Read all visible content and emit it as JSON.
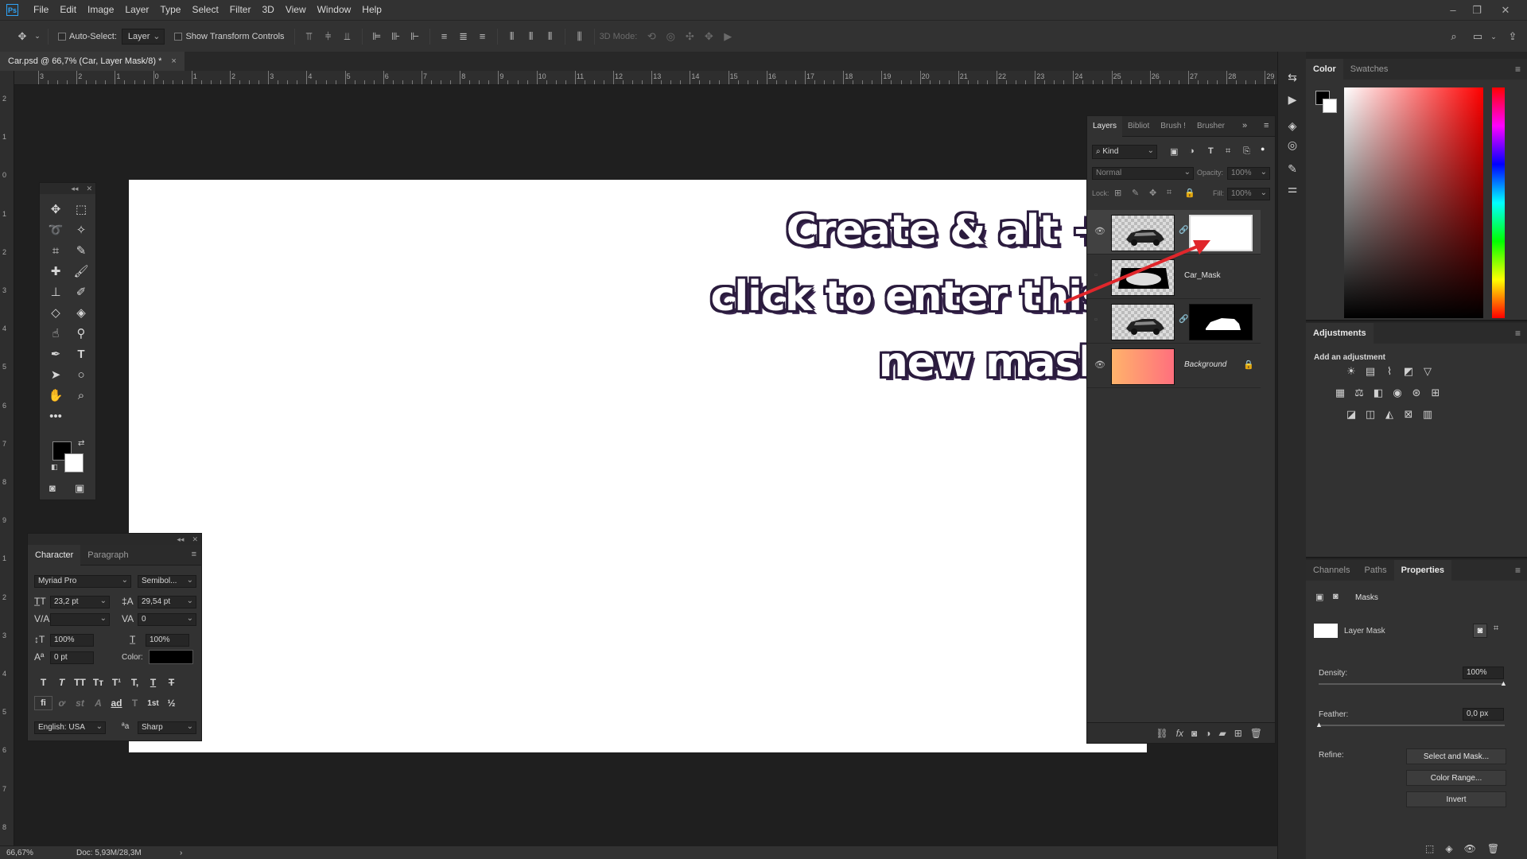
{
  "app": {
    "logo": "Ps"
  },
  "menubar": {
    "items": [
      "File",
      "Edit",
      "Image",
      "Layer",
      "Type",
      "Select",
      "Filter",
      "3D",
      "View",
      "Window",
      "Help"
    ]
  },
  "optionsbar": {
    "auto_select_label": "Auto-Select:",
    "auto_select_value": "Layer",
    "show_transform_label": "Show Transform Controls",
    "mode_3d_label": "3D Mode:"
  },
  "document": {
    "tab_title": "Car.psd @ 66,7% (Car, Layer Mask/8) *",
    "close": "×"
  },
  "rulers": {
    "h_labels": [
      "3",
      "2",
      "1",
      "0",
      "1",
      "2",
      "3",
      "4",
      "5",
      "6",
      "7",
      "8",
      "9",
      "10",
      "11",
      "12",
      "13",
      "14",
      "15",
      "16",
      "17",
      "18",
      "19",
      "20",
      "21",
      "22",
      "23",
      "24",
      "25",
      "26",
      "27",
      "28",
      "29"
    ],
    "v_labels": [
      "2",
      "1",
      "0",
      "1",
      "2",
      "3",
      "4",
      "5",
      "6",
      "7",
      "8",
      "9",
      "1",
      "2",
      "3",
      "4",
      "5",
      "6",
      "7",
      "8",
      "9"
    ]
  },
  "annotation": {
    "line1": "Create & alt +",
    "line2": "click to enter this",
    "line3": "new mask"
  },
  "status": {
    "zoom": "66,67%",
    "doc": "Doc: 5,93M/28,3M",
    "arrow": "›"
  },
  "character": {
    "tabs": [
      "Character",
      "Paragraph"
    ],
    "font_family": "Myriad Pro",
    "font_style": "Semibol...",
    "size": "23,2 pt",
    "leading": "29,54 pt",
    "kerning": "",
    "tracking": "0",
    "vscale": "100%",
    "hscale": "100%",
    "baseline": "0 pt",
    "color_label": "Color:",
    "type_buttons": [
      "T",
      "T",
      "TT",
      "Tт",
      "T¹",
      "T,",
      "T",
      "T"
    ],
    "ot_buttons": [
      "fi",
      "ơ",
      "st",
      "A",
      "ad",
      "T",
      "1st",
      "½"
    ],
    "language": "English: USA",
    "aa_label": "ªa",
    "antialias": "Sharp"
  },
  "layers": {
    "tabs": [
      "Layers",
      "Bibliot",
      "Brush !",
      "Brusher"
    ],
    "filter_kind": "Kind",
    "blend_mode": "Normal",
    "opacity_label": "Opacity:",
    "opacity": "100%",
    "lock_label": "Lock:",
    "fill_label": "Fill:",
    "fill": "100%",
    "items": [
      {
        "name": "",
        "visible": true
      },
      {
        "name": "Car_Mask",
        "visible": false
      },
      {
        "name": "",
        "visible": false
      },
      {
        "name": "Background",
        "visible": true
      }
    ]
  },
  "color_panel": {
    "tabs": [
      "Color",
      "Swatches"
    ]
  },
  "adjustments": {
    "title": "Adjustments",
    "subtitle": "Add an adjustment"
  },
  "properties": {
    "tabs": [
      "Channels",
      "Paths",
      "Properties"
    ],
    "section": "Masks",
    "mask_label": "Layer Mask",
    "density_label": "Density:",
    "density": "100%",
    "feather_label": "Feather:",
    "feather": "0,0 px",
    "refine_label": "Refine:",
    "btn_select_mask": "Select and Mask...",
    "btn_color_range": "Color Range...",
    "btn_invert": "Invert"
  },
  "colors": {
    "accent": "#2fa3f6",
    "annotation_text": "#ffffff",
    "annotation_stroke": "#2a1b3d",
    "arrow": "#e0262b"
  }
}
